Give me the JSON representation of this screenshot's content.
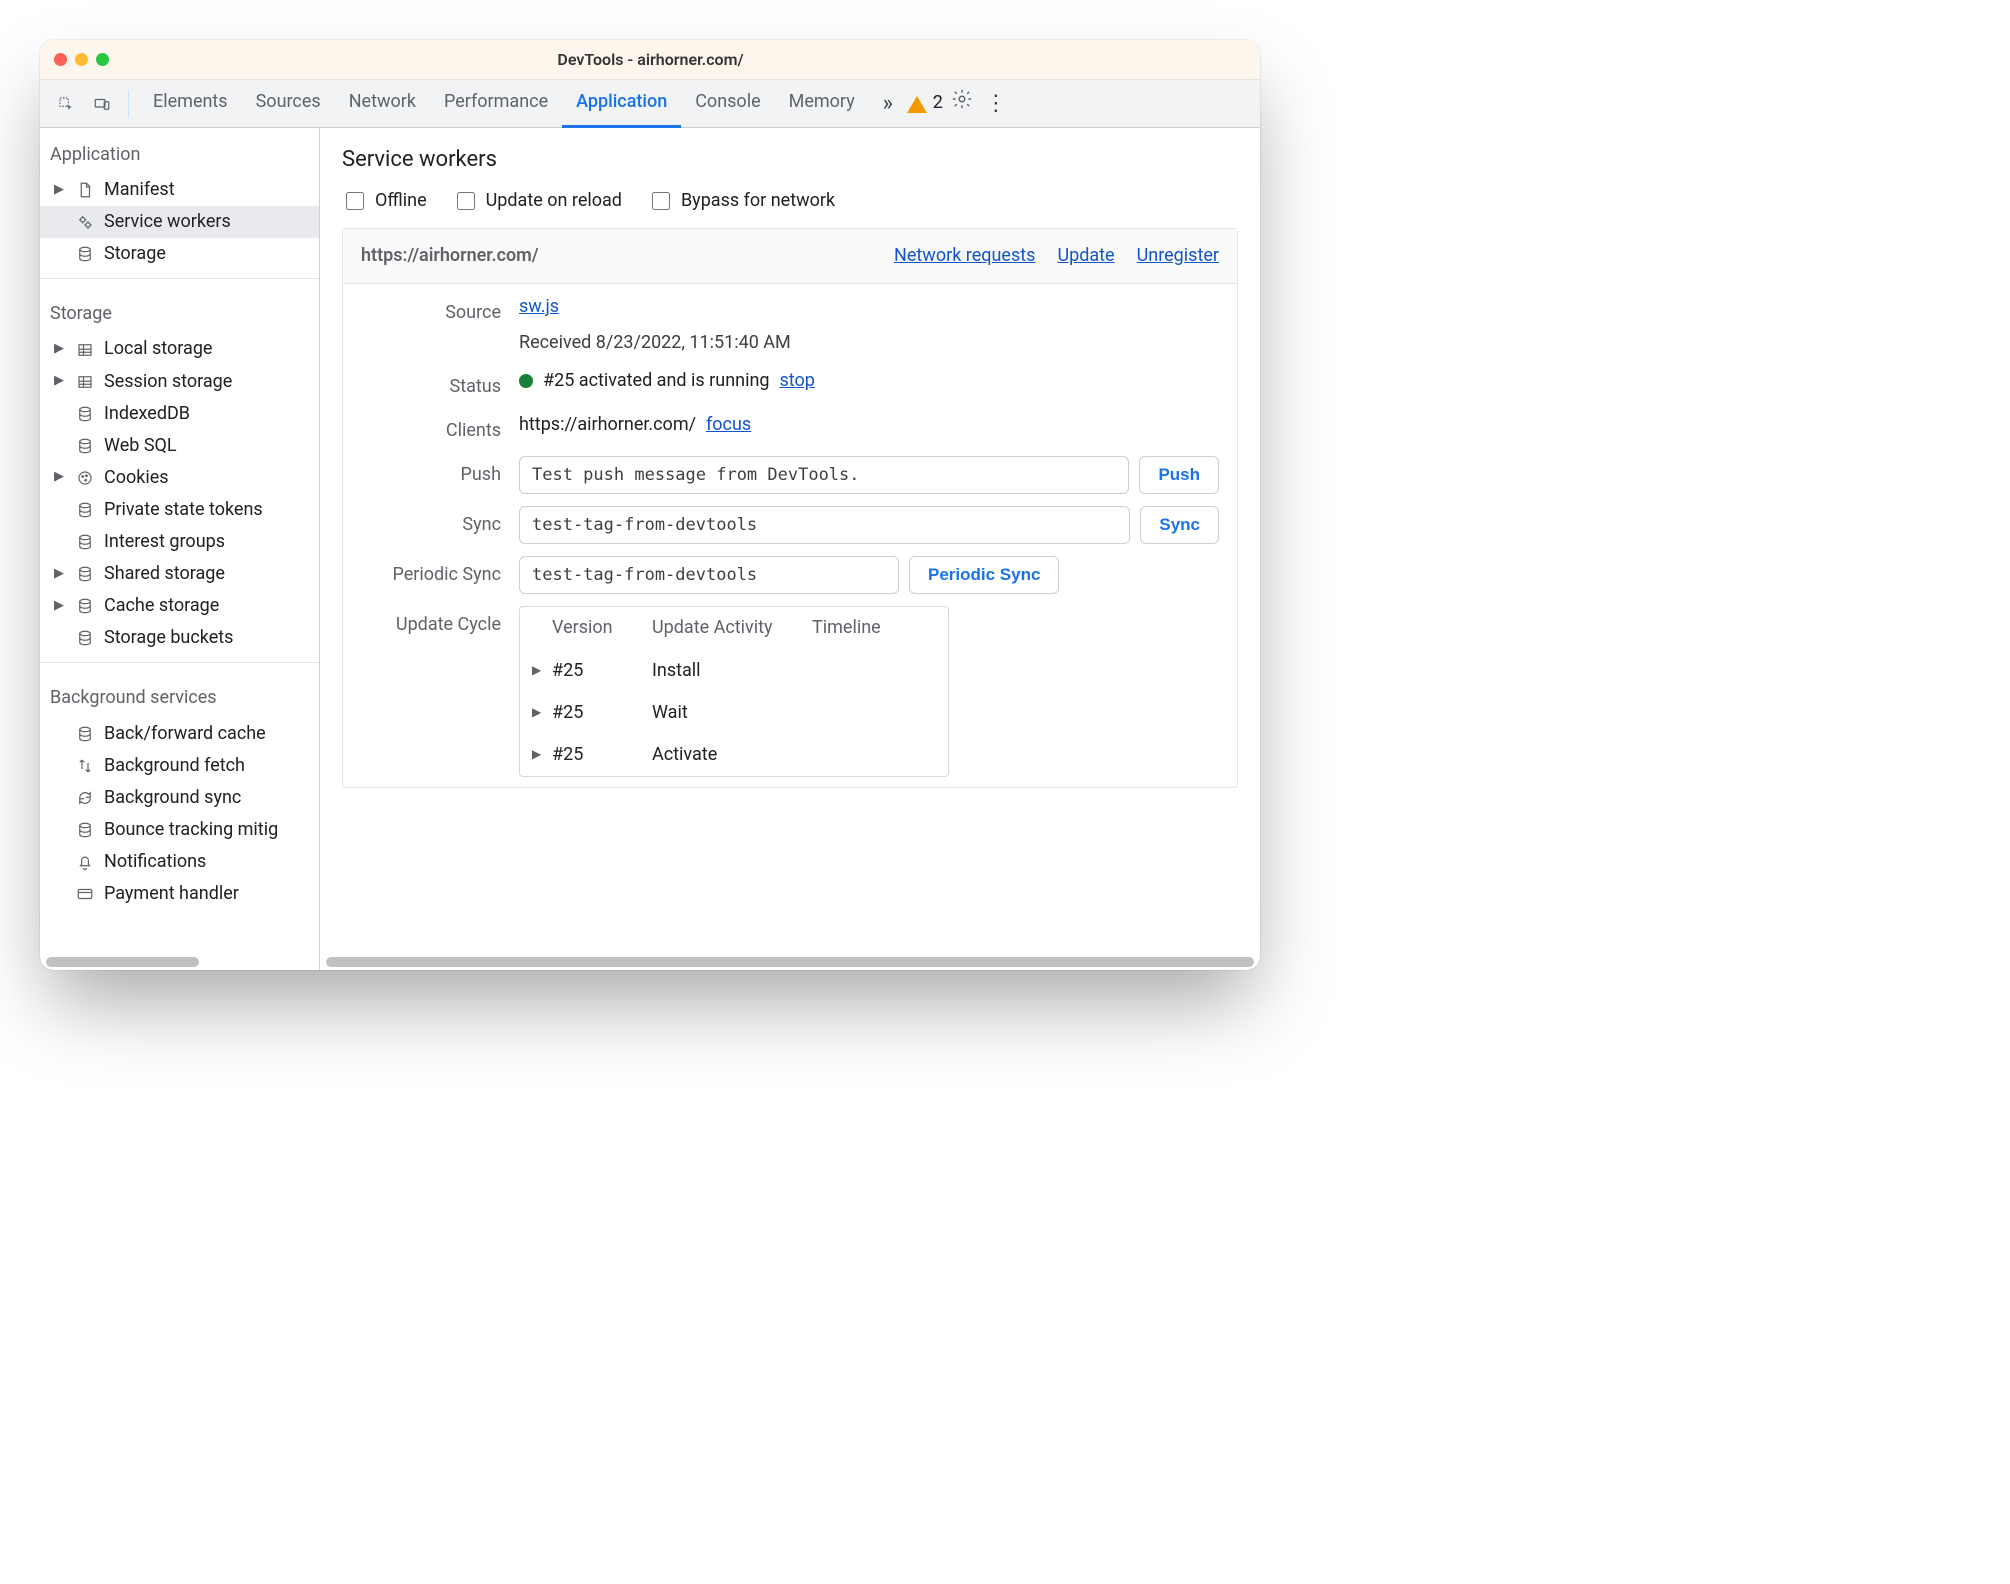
{
  "title": "DevTools - airhorner.com/",
  "toolbar": {
    "tabs": [
      "Elements",
      "Sources",
      "Network",
      "Performance",
      "Application",
      "Console",
      "Memory"
    ],
    "active_idx": 4,
    "warn_count": "2"
  },
  "sidebar": {
    "g_app": "Application",
    "app": [
      {
        "label": "Manifest",
        "icon": "file",
        "arrow": true
      },
      {
        "label": "Service workers",
        "icon": "gears",
        "selected": true
      },
      {
        "label": "Storage",
        "icon": "db"
      }
    ],
    "g_storage": "Storage",
    "storage": [
      {
        "label": "Local storage",
        "icon": "table",
        "arrow": true
      },
      {
        "label": "Session storage",
        "icon": "table",
        "arrow": true
      },
      {
        "label": "IndexedDB",
        "icon": "db"
      },
      {
        "label": "Web SQL",
        "icon": "db"
      },
      {
        "label": "Cookies",
        "icon": "cookie",
        "arrow": true
      },
      {
        "label": "Private state tokens",
        "icon": "db"
      },
      {
        "label": "Interest groups",
        "icon": "db"
      },
      {
        "label": "Shared storage",
        "icon": "db",
        "arrow": true
      },
      {
        "label": "Cache storage",
        "icon": "db",
        "arrow": true
      },
      {
        "label": "Storage buckets",
        "icon": "db"
      }
    ],
    "g_bg": "Background services",
    "bg": [
      {
        "label": "Back/forward cache",
        "icon": "db"
      },
      {
        "label": "Background fetch",
        "icon": "updown"
      },
      {
        "label": "Background sync",
        "icon": "cycle"
      },
      {
        "label": "Bounce tracking mitig",
        "icon": "db"
      },
      {
        "label": "Notifications",
        "icon": "bell"
      },
      {
        "label": "Payment handler",
        "icon": "card"
      }
    ]
  },
  "pane": {
    "h": "Service workers",
    "ck_offline": "Offline",
    "ck_update": "Update on reload",
    "ck_bypass": "Bypass for network",
    "sw_url": "https://airhorner.com/",
    "lk_net": "Network requests",
    "lk_update": "Update",
    "lk_unreg": "Unregister",
    "k_source": "Source",
    "v_source_link": "sw.js",
    "v_received": "Received 8/23/2022, 11:51:40 AM",
    "k_status": "Status",
    "v_status": "#25 activated and is running",
    "v_stop": "stop",
    "k_clients": "Clients",
    "v_client_url": "https://airhorner.com/",
    "v_focus": "focus",
    "k_push": "Push",
    "in_push": "Test push message from DevTools.",
    "btn_push": "Push",
    "k_sync": "Sync",
    "in_sync": "test-tag-from-devtools",
    "btn_sync": "Sync",
    "k_psync": "Periodic Sync",
    "in_psync": "test-tag-from-devtools",
    "btn_psync": "Periodic Sync",
    "k_cycle": "Update Cycle",
    "cy_h1": "Version",
    "cy_h2": "Update Activity",
    "cy_h3": "Timeline",
    "cy_rows": [
      {
        "ver": "#25",
        "act": "Install",
        "bar": "thin"
      },
      {
        "ver": "#25",
        "act": "Wait",
        "bar": "thin"
      },
      {
        "ver": "#25",
        "act": "Activate",
        "bar": "wide"
      }
    ]
  }
}
